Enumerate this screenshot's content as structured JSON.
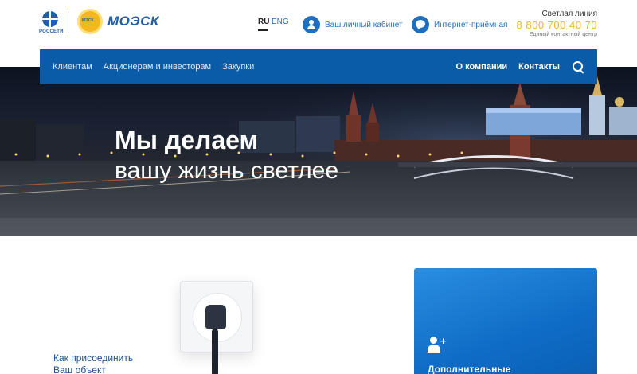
{
  "header": {
    "logo_rosseti": "РОССЕТИ",
    "logo_moesk": "МОЭСК",
    "lang_ru": "RU",
    "lang_en": "ENG",
    "account_label": "Ваш личный кабинет",
    "reception_label": "Интернет-приёмная",
    "hotline_title": "Светлая линия",
    "hotline_phone": "8 800 700 40 70",
    "hotline_sub": "Единый контактный центр"
  },
  "nav": {
    "left": [
      "Клиентам",
      "Акционерам и инвесторам",
      "Закупки"
    ],
    "right": [
      "О компании",
      "Контакты"
    ]
  },
  "hero": {
    "line1": "Мы делаем",
    "line2": "вашу жизнь светлее"
  },
  "content": {
    "connect_line1": "Как присоединить",
    "connect_line2": "Ваш объект",
    "card_title": "Дополнительные"
  },
  "colors": {
    "brand_blue": "#0b5ca8",
    "accent_gold": "#f0b429",
    "link_blue": "#1f6fc0"
  }
}
